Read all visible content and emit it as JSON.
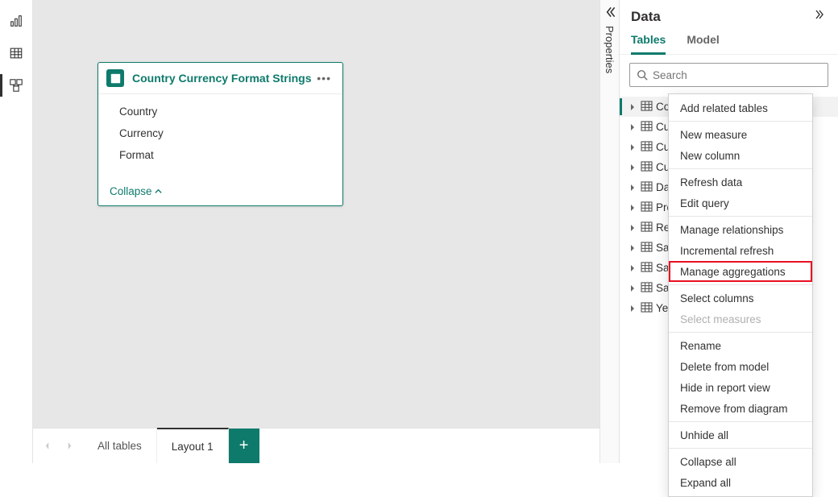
{
  "leftRail": {
    "buttons": [
      "report-view",
      "table-view",
      "model-view"
    ],
    "activeIndex": 2
  },
  "tableCard": {
    "title": "Country Currency Format Strings",
    "fields": [
      "Country",
      "Currency",
      "Format"
    ],
    "collapseLabel": "Collapse"
  },
  "bottomTabs": {
    "items": [
      "All tables",
      "Layout 1"
    ],
    "activeIndex": 1
  },
  "propertiesLabel": "Properties",
  "dataPanel": {
    "title": "Data",
    "tabs": [
      "Tables",
      "Model"
    ],
    "activeTab": 0,
    "searchPlaceholder": "Search",
    "tree": [
      "Cou…",
      "Cur…",
      "Cur…",
      "Cus…",
      "Dat…",
      "Pro…",
      "Res…",
      "Sal…",
      "Sal…",
      "Sal…",
      "Yea…"
    ],
    "selectedIndex": 0
  },
  "contextMenu": {
    "groups": [
      [
        "Add related tables"
      ],
      [
        "New measure",
        "New column"
      ],
      [
        "Refresh data",
        "Edit query"
      ],
      [
        "Manage relationships",
        "Incremental refresh",
        "Manage aggregations"
      ],
      [
        "Select columns",
        "Select measures"
      ],
      [
        "Rename",
        "Delete from model",
        "Hide in report view",
        "Remove from diagram"
      ],
      [
        "Unhide all"
      ],
      [
        "Collapse all",
        "Expand all"
      ]
    ],
    "disabled": [
      "Select measures"
    ],
    "highlighted": "Manage aggregations"
  }
}
